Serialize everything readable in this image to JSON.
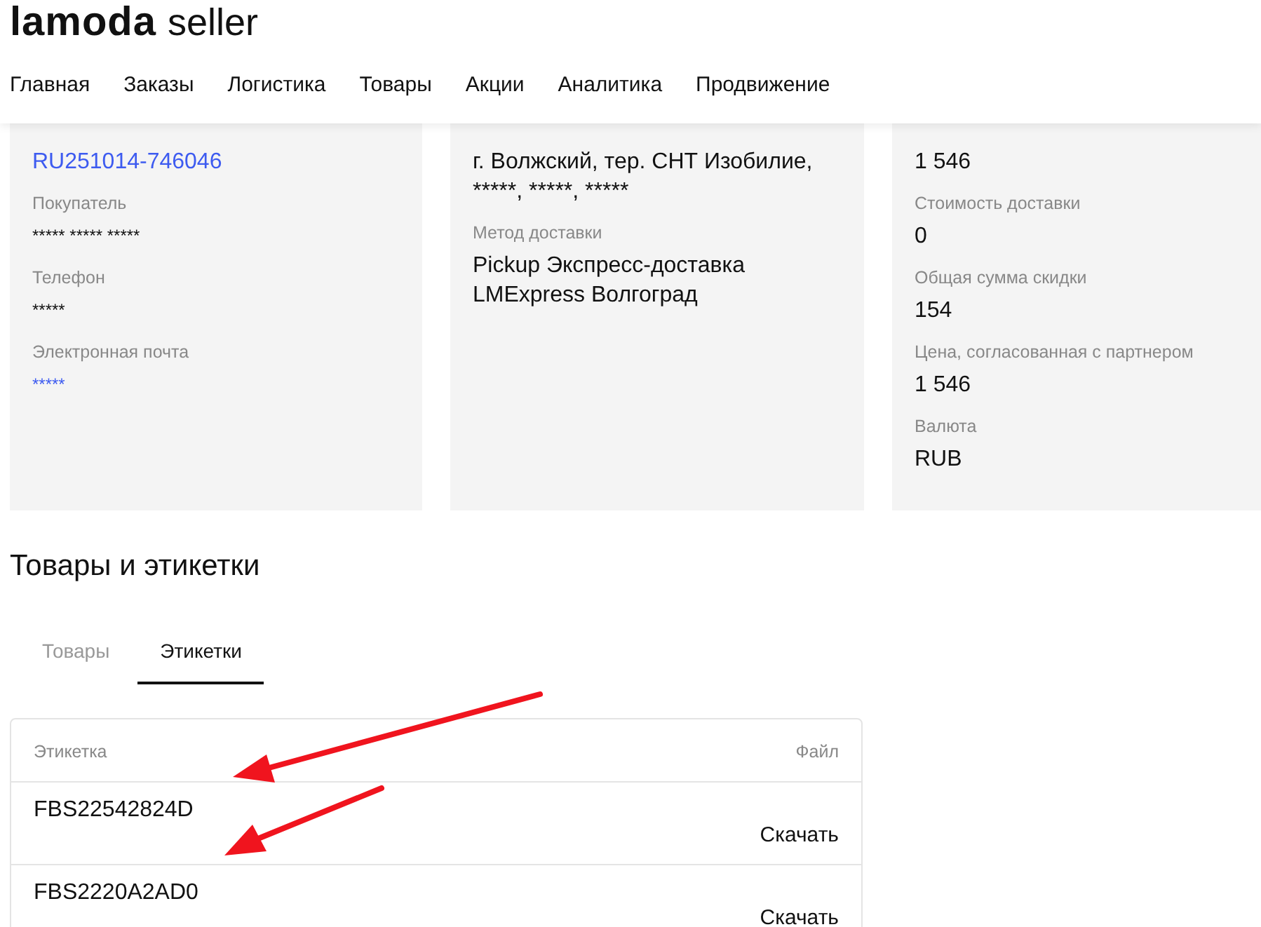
{
  "header": {
    "logo": "lamoda",
    "logo_suffix": "seller"
  },
  "nav": [
    {
      "label": "Главная"
    },
    {
      "label": "Заказы"
    },
    {
      "label": "Логистика"
    },
    {
      "label": "Товары"
    },
    {
      "label": "Акции"
    },
    {
      "label": "Аналитика"
    },
    {
      "label": "Продвижение"
    }
  ],
  "cards": [
    {
      "fields": [
        {
          "value": "RU251014-746046",
          "kind": "link"
        },
        {
          "label": "Покупатель",
          "value": "***** ***** *****",
          "kind": "small"
        },
        {
          "label": "Телефон",
          "value": "*****",
          "kind": "small"
        },
        {
          "label": "Электронная почта",
          "value": "*****",
          "kind": "smalllink"
        }
      ]
    },
    {
      "fields": [
        {
          "value": "г. Волжский, тер. СНТ Изобилие, *****, *****, *****",
          "kind": "text"
        },
        {
          "label": "Метод доставки",
          "value": "Pickup Экспресс-доставка LMExpress Волгоград",
          "kind": "text"
        }
      ]
    },
    {
      "fields": [
        {
          "value": "1 546",
          "kind": "text"
        },
        {
          "label": "Стоимость доставки",
          "value": "0",
          "kind": "text"
        },
        {
          "label": "Общая сумма скидки",
          "value": "154",
          "kind": "text"
        },
        {
          "label": "Цена, согласованная с партнером",
          "value": "1 546",
          "kind": "text"
        },
        {
          "label": "Валюта",
          "value": "RUB",
          "kind": "text"
        }
      ]
    }
  ],
  "section_title": "Товары и этикетки",
  "tabs": [
    {
      "label": "Товары",
      "selected": false
    },
    {
      "label": "Этикетки",
      "selected": true
    }
  ],
  "table": {
    "columns": [
      "Этикетка",
      "Файл"
    ],
    "rows": [
      {
        "label": "FBS22542824D",
        "file": "Скачать"
      },
      {
        "label": "FBS2220A2AD0",
        "file": "Скачать"
      }
    ]
  }
}
